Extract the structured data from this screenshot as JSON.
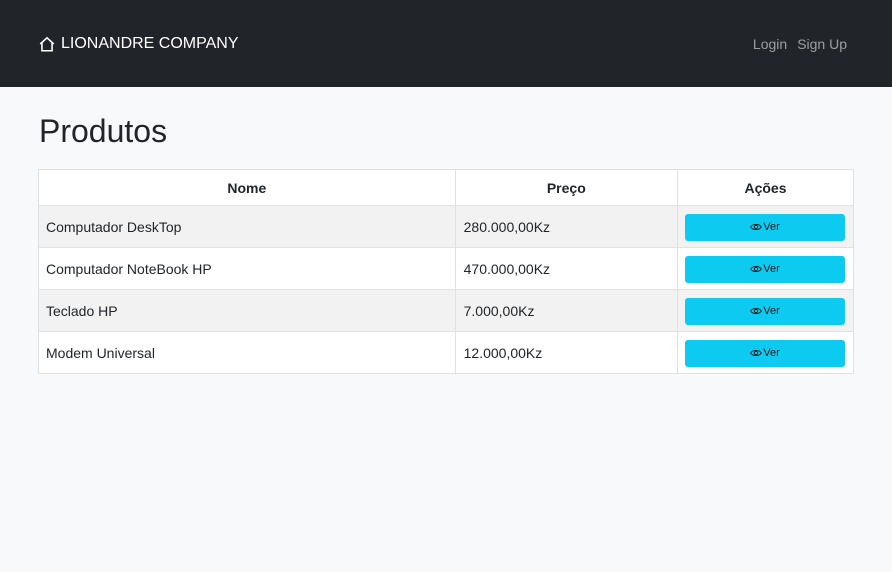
{
  "navbar": {
    "brand_icon": "house-icon",
    "brand": "LIONANDRE COMPANY",
    "login": "Login",
    "signup": "Sign Up"
  },
  "page": {
    "title": "Produtos"
  },
  "table": {
    "headers": {
      "name": "Nome",
      "price": "Preço",
      "actions": "Ações"
    },
    "rows": [
      {
        "name": "Computador DeskTop",
        "price": "280.000,00Kz",
        "action": "Ver"
      },
      {
        "name": "Computador NoteBook HP",
        "price": "470.000,00Kz",
        "action": "Ver"
      },
      {
        "name": "Teclado HP",
        "price": "7.000,00Kz",
        "action": "Ver"
      },
      {
        "name": "Modem Universal",
        "price": "12.000,00Kz",
        "action": "Ver"
      }
    ]
  },
  "colors": {
    "navbar_bg": "#212529",
    "button_bg": "#0dcaf0",
    "page_bg": "#f8f9fa"
  }
}
